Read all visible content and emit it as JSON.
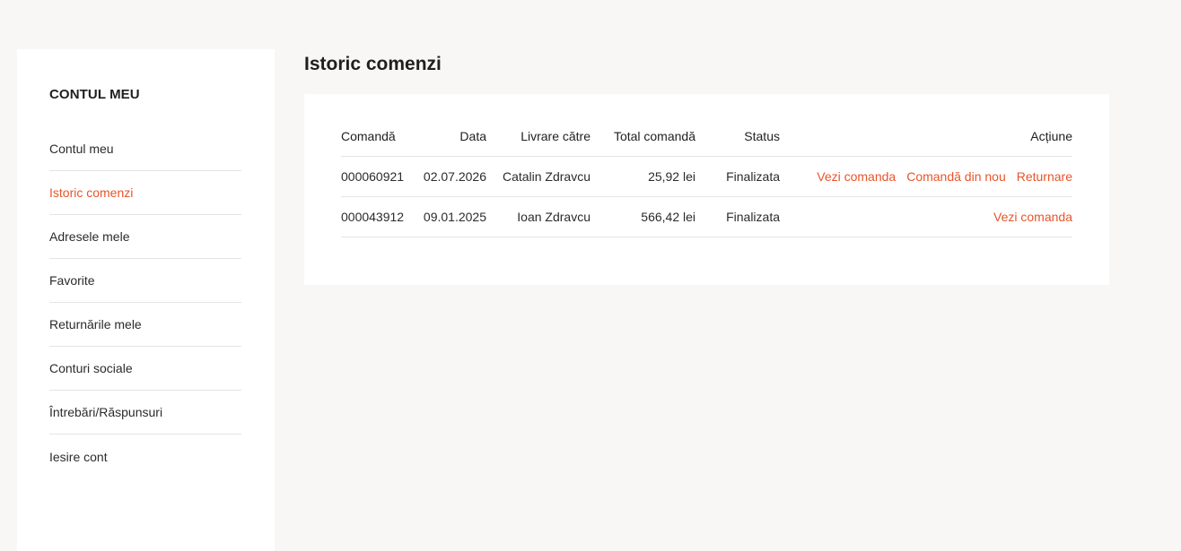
{
  "sidebar": {
    "title": "CONTUL MEU",
    "items": [
      {
        "label": "Contul meu"
      },
      {
        "label": "Istoric comenzi"
      },
      {
        "label": "Adresele mele"
      },
      {
        "label": "Favorite"
      },
      {
        "label": "Returnările mele"
      },
      {
        "label": "Conturi sociale"
      },
      {
        "label": "Întrebări/Răspunsuri"
      },
      {
        "label": "Iesire cont"
      }
    ],
    "active_item": "Istoric comenzi"
  },
  "page": {
    "title": "Istoric comenzi"
  },
  "orders": {
    "headers": {
      "order": "Comandă",
      "date": "Data",
      "ship_to": "Livrare către",
      "total": "Total comandă",
      "status": "Status",
      "action": "Acțiune"
    },
    "rows": [
      {
        "order": "000060921",
        "date": "02.07.2026",
        "ship_to": "Catalin Zdravcu",
        "total": "25,92 lei",
        "status": "Finalizata",
        "actions": [
          "Vezi comanda",
          "Comandă din nou",
          "Returnare"
        ]
      },
      {
        "order": "000043912",
        "date": "09.01.2025",
        "ship_to": "Ioan Zdravcu",
        "total": "566,42 lei",
        "status": "Finalizata",
        "actions": [
          "Vezi comanda"
        ]
      }
    ]
  },
  "colors": {
    "accent": "#e8542a",
    "background": "#f8f7f5",
    "panel": "#ffffff",
    "divider": "#e4e4e4"
  }
}
